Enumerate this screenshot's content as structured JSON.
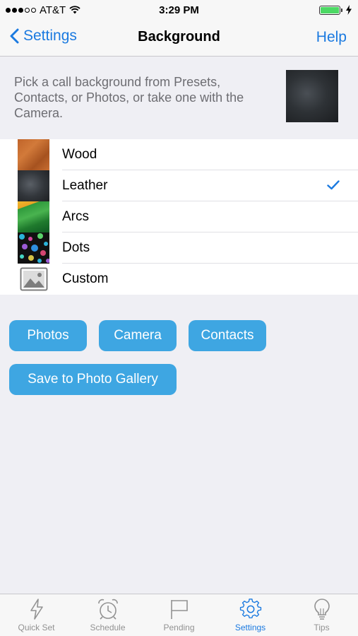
{
  "status_bar": {
    "carrier": "AT&T",
    "time": "3:29 PM"
  },
  "nav": {
    "back_label": "Settings",
    "title": "Background",
    "help_label": "Help"
  },
  "description": "Pick a call background from Presets, Contacts, or Photos, or take one with the Camera.",
  "backgrounds": [
    {
      "label": "Wood",
      "thumb": "wood",
      "selected": false
    },
    {
      "label": "Leather",
      "thumb": "leather",
      "selected": true
    },
    {
      "label": "Arcs",
      "thumb": "arcs",
      "selected": false
    },
    {
      "label": "Dots",
      "thumb": "dots",
      "selected": false
    },
    {
      "label": "Custom",
      "thumb": "image-placeholder-icon",
      "selected": false
    }
  ],
  "buttons": {
    "photos": "Photos",
    "camera": "Camera",
    "contacts": "Contacts",
    "save_gallery": "Save to Photo Gallery"
  },
  "tabs": [
    {
      "label": "Quick Set",
      "icon": "lightning-icon",
      "active": false
    },
    {
      "label": "Schedule",
      "icon": "alarm-clock-icon",
      "active": false
    },
    {
      "label": "Pending",
      "icon": "flag-icon",
      "active": false
    },
    {
      "label": "Settings",
      "icon": "gear-icon",
      "active": true
    },
    {
      "label": "Tips",
      "icon": "lightbulb-icon",
      "active": false
    }
  ],
  "colors": {
    "accent": "#1b7ae0",
    "button": "#3ea6e2",
    "background": "#efeff4"
  }
}
